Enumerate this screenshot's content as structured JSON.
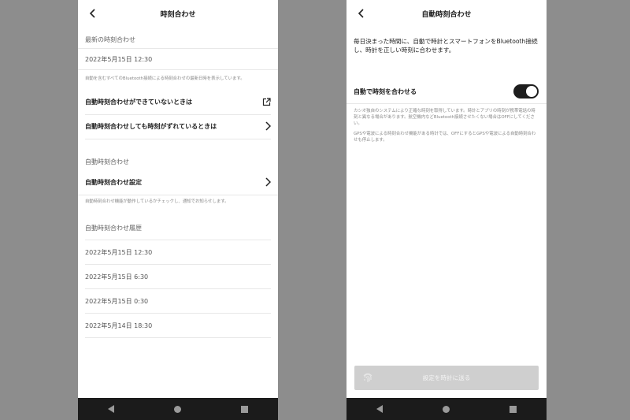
{
  "left": {
    "title": "時刻合わせ",
    "latest": {
      "label": "最新の時刻合わせ",
      "datetime": "2022年5月15日 12:30",
      "note": "自動を含むすべてのBluetooth接続による時刻合わせの最新日時を表示しています。"
    },
    "help_rows": [
      {
        "label": "自動時刻合わせができていないときは",
        "icon": "external-link-icon"
      },
      {
        "label": "自動時刻合わせしても時刻がずれているときは",
        "icon": "chevron-right-icon"
      }
    ],
    "auto_section": {
      "label": "自動時刻合わせ",
      "settings_label": "自動時刻合わせ設定",
      "note": "自動時刻合わせ機能が動作しているかチェックし、通知でお知らせします。"
    },
    "history": {
      "label": "自動時刻合わせ履歴",
      "items": [
        "2022年5月15日 12:30",
        "2022年5月15日 6:30",
        "2022年5月15日 0:30",
        "2022年5月14日 18:30"
      ]
    }
  },
  "right": {
    "title": "自動時刻合わせ",
    "intro": "毎日決まった時間に、自動で時計とスマートフォンをBluetooth接続し、時計を正しい時刻に合わせます。",
    "toggle": {
      "label": "自動で時刻を合わせる",
      "state": "on"
    },
    "note1": "カシオ独自のシステムにより正確な時刻を取得しています。時計とアプリの時刻が携帯電話の時刻と異なる場合があります。航空機内などBluetooth接続させたくない場合はOFFにしてください。",
    "note2": "GPSや電波による時刻合わせ機能がある時計では、OFFにするとGPSや電波による自動時刻合わせも停止します。",
    "button_label": "設定を時計に送る"
  },
  "colors": {
    "background": "#8d8d8d",
    "navbar": "#1b1b1b",
    "toggle_on": "#1d1d1d",
    "button_disabled": "#cfcfcf"
  }
}
